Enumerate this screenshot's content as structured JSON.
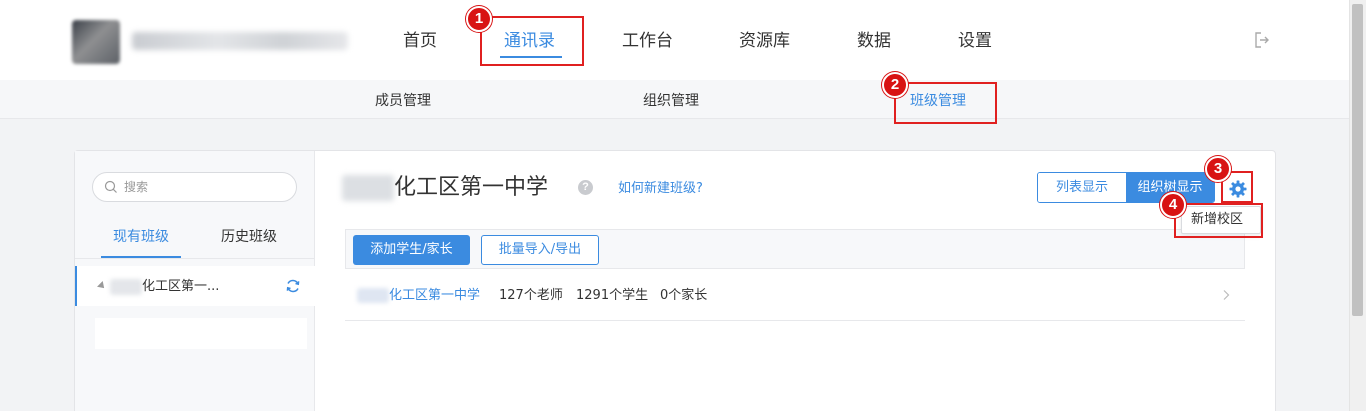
{
  "topnav": {
    "items": [
      {
        "label": "首页"
      },
      {
        "label": "通讯录"
      },
      {
        "label": "工作台"
      },
      {
        "label": "资源库"
      },
      {
        "label": "数据"
      },
      {
        "label": "设置"
      }
    ],
    "active_index": 1
  },
  "subnav": {
    "items": [
      {
        "label": "成员管理"
      },
      {
        "label": "组织管理"
      },
      {
        "label": "班级管理"
      }
    ],
    "active_index": 2
  },
  "sidebar": {
    "search_placeholder": "搜索",
    "tabs": [
      {
        "label": "现有班级"
      },
      {
        "label": "历史班级"
      }
    ],
    "tree": {
      "label": "化工区第一..."
    }
  },
  "main": {
    "school_title": "化工区第一中学",
    "help_link": "如何新建班级?",
    "view_toggle": {
      "list": "列表显示",
      "tree": "组织树显示"
    },
    "toolbar": {
      "add": "添加学生/家长",
      "import": "批量导入/导出"
    },
    "row": {
      "school": "化工区第一中学",
      "teachers": "127个老师",
      "students": "1291个学生",
      "parents": "0个家长"
    },
    "dropdown": {
      "item": "新增校区"
    }
  },
  "annotations": {
    "badges": [
      "1",
      "2",
      "3",
      "4"
    ],
    "color": "#e02020"
  },
  "colors": {
    "accent": "#3b8be0"
  }
}
